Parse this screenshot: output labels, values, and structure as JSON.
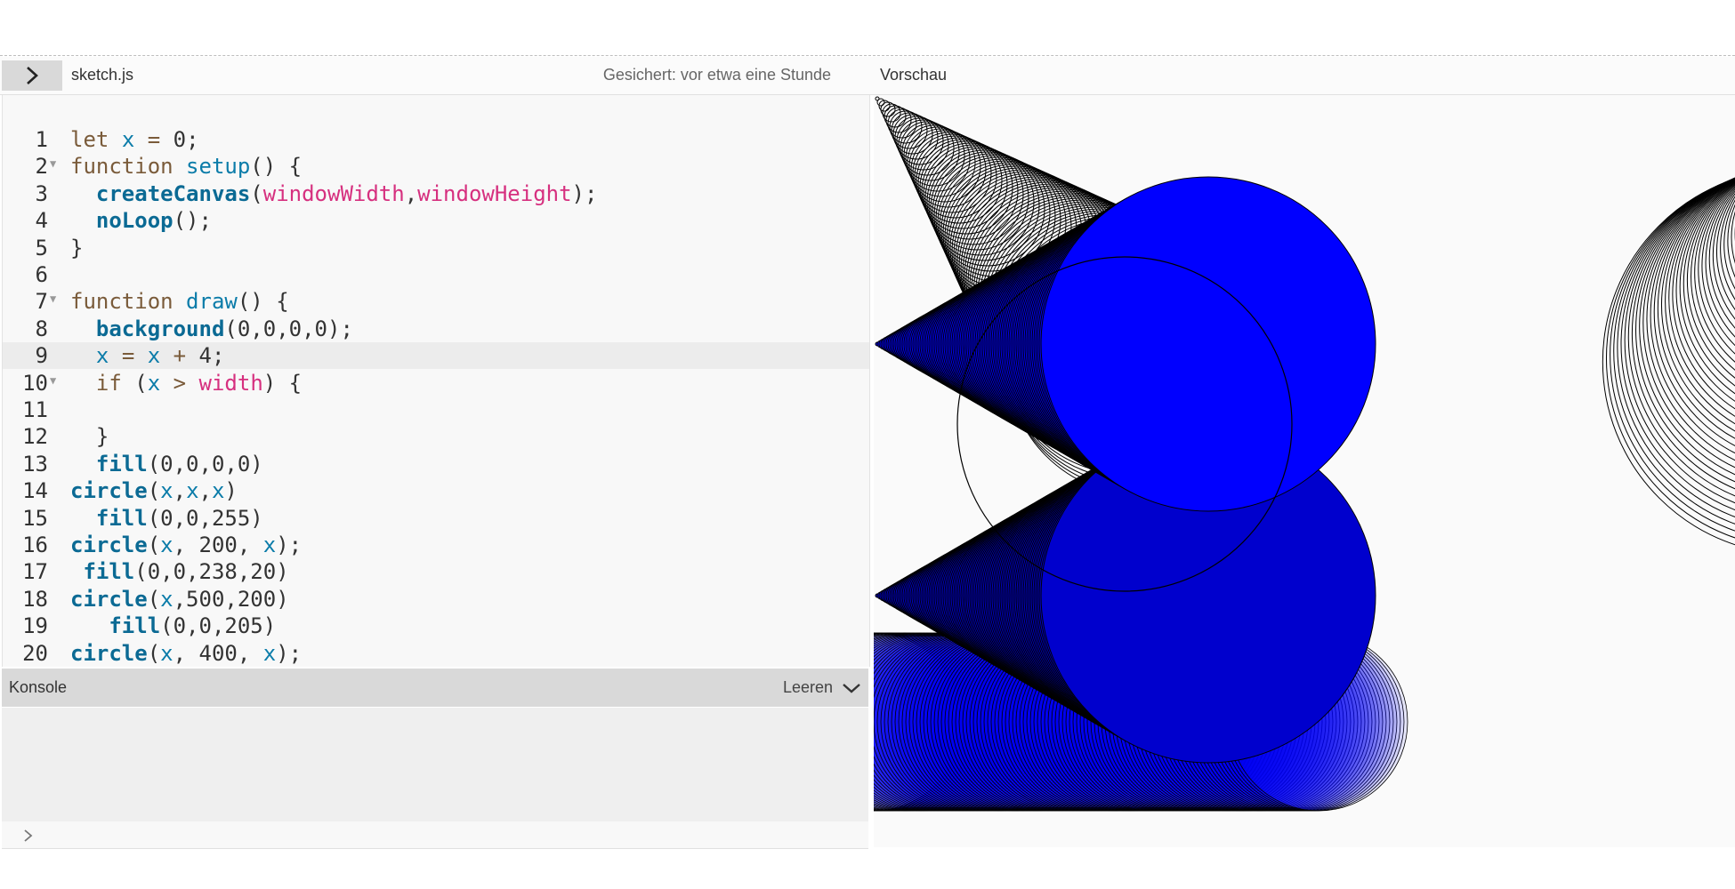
{
  "header": {
    "file_name": "sketch.js",
    "save_status": "Gesichert: vor etwa eine Stunde",
    "preview_label": "Vorschau",
    "toggle_icon": "chevron-right-icon"
  },
  "editor": {
    "active_line": 9,
    "lines": [
      {
        "n": "1",
        "fold": false,
        "code": "let x = 0;"
      },
      {
        "n": "2",
        "fold": true,
        "code": "function setup() {"
      },
      {
        "n": "3",
        "fold": false,
        "code": "  createCanvas(windowWidth,windowHeight);"
      },
      {
        "n": "4",
        "fold": false,
        "code": "  noLoop();"
      },
      {
        "n": "5",
        "fold": false,
        "code": "}"
      },
      {
        "n": "6",
        "fold": false,
        "code": ""
      },
      {
        "n": "7",
        "fold": true,
        "code": "function draw() {"
      },
      {
        "n": "8",
        "fold": false,
        "code": "  background(0,0,0,0);"
      },
      {
        "n": "9",
        "fold": false,
        "code": "  x = x + 4;"
      },
      {
        "n": "10",
        "fold": true,
        "code": "  if (x > width) {"
      },
      {
        "n": "11",
        "fold": false,
        "code": ""
      },
      {
        "n": "12",
        "fold": false,
        "code": "  }"
      },
      {
        "n": "13",
        "fold": false,
        "code": "  fill(0,0,0,0)"
      },
      {
        "n": "14",
        "fold": false,
        "code": "circle(x,x,x)"
      },
      {
        "n": "15",
        "fold": false,
        "code": "  fill(0,0,255)"
      },
      {
        "n": "16",
        "fold": false,
        "code": "circle(x, 200, x);"
      },
      {
        "n": "17",
        "fold": false,
        "code": " fill(0,0,238,20)"
      },
      {
        "n": "18",
        "fold": false,
        "code": "circle(x,500,200)"
      },
      {
        "n": "19",
        "fold": false,
        "code": "   fill(0,0,205)"
      },
      {
        "n": "20",
        "fold": false,
        "code": "circle(x, 400, x);"
      }
    ]
  },
  "console": {
    "title": "Konsole",
    "clear_label": "Leeren",
    "collapse_icon": "chevron-down-icon",
    "prompt_icon": "prompt-chevron-icon"
  },
  "colors": {
    "keyword": "#7a5b3a",
    "function": "#0b7ca9",
    "global": "#d6307f",
    "fill_blue": "#0000ff",
    "fill_blue_mid": "#0000cd"
  }
}
